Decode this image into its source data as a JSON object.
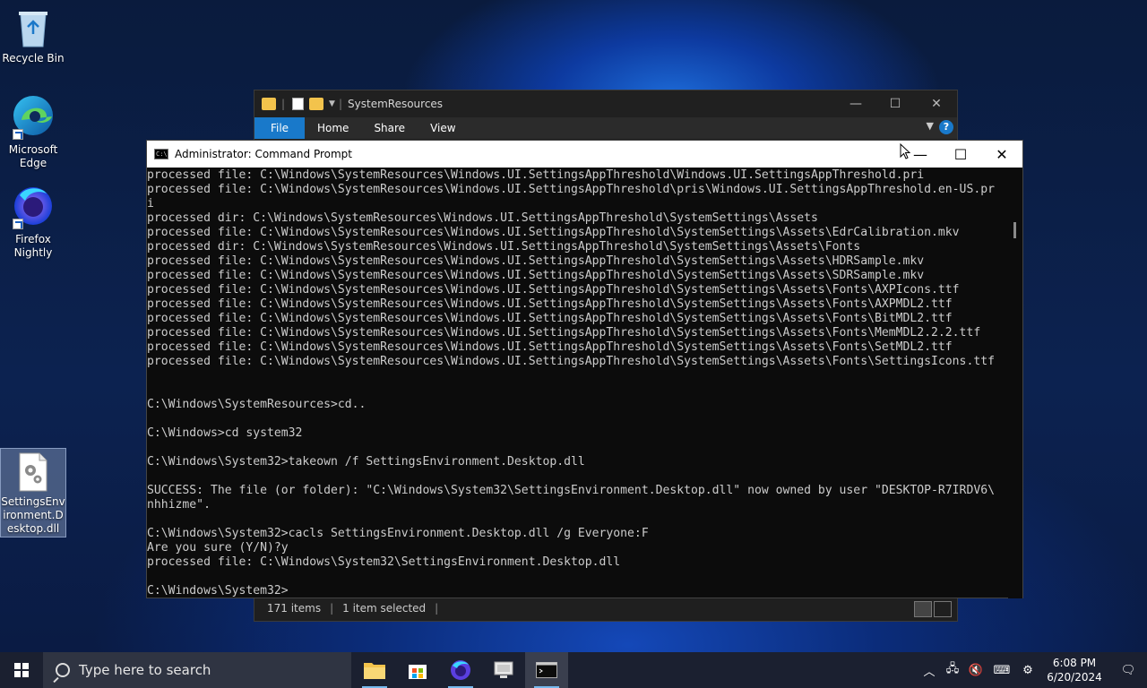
{
  "desktop": {
    "icons": [
      {
        "label": "Recycle Bin",
        "icon": "recycle-bin-icon"
      },
      {
        "label": "Microsoft Edge",
        "icon": "edge-icon"
      },
      {
        "label": "Firefox Nightly",
        "icon": "firefox-nightly-icon"
      },
      {
        "label": "SettingsEnvironment.Desktop.dll",
        "icon": "dll-file-icon"
      }
    ]
  },
  "explorer": {
    "title": "SystemResources",
    "tabs": [
      "File",
      "Home",
      "Share",
      "View"
    ],
    "status": {
      "items": "171 items",
      "selected": "1 item selected"
    },
    "help": "?"
  },
  "cmd": {
    "title": "Administrator: Command Prompt",
    "lines": [
      "processed file: C:\\Windows\\SystemResources\\Windows.UI.SettingsAppThreshold\\Windows.UI.SettingsAppThreshold.pri",
      "processed file: C:\\Windows\\SystemResources\\Windows.UI.SettingsAppThreshold\\pris\\Windows.UI.SettingsAppThreshold.en-US.pr",
      "i",
      "processed dir: C:\\Windows\\SystemResources\\Windows.UI.SettingsAppThreshold\\SystemSettings\\Assets",
      "processed file: C:\\Windows\\SystemResources\\Windows.UI.SettingsAppThreshold\\SystemSettings\\Assets\\EdrCalibration.mkv",
      "processed dir: C:\\Windows\\SystemResources\\Windows.UI.SettingsAppThreshold\\SystemSettings\\Assets\\Fonts",
      "processed file: C:\\Windows\\SystemResources\\Windows.UI.SettingsAppThreshold\\SystemSettings\\Assets\\HDRSample.mkv",
      "processed file: C:\\Windows\\SystemResources\\Windows.UI.SettingsAppThreshold\\SystemSettings\\Assets\\SDRSample.mkv",
      "processed file: C:\\Windows\\SystemResources\\Windows.UI.SettingsAppThreshold\\SystemSettings\\Assets\\Fonts\\AXPIcons.ttf",
      "processed file: C:\\Windows\\SystemResources\\Windows.UI.SettingsAppThreshold\\SystemSettings\\Assets\\Fonts\\AXPMDL2.ttf",
      "processed file: C:\\Windows\\SystemResources\\Windows.UI.SettingsAppThreshold\\SystemSettings\\Assets\\Fonts\\BitMDL2.ttf",
      "processed file: C:\\Windows\\SystemResources\\Windows.UI.SettingsAppThreshold\\SystemSettings\\Assets\\Fonts\\MemMDL2.2.2.ttf",
      "processed file: C:\\Windows\\SystemResources\\Windows.UI.SettingsAppThreshold\\SystemSettings\\Assets\\Fonts\\SetMDL2.ttf",
      "processed file: C:\\Windows\\SystemResources\\Windows.UI.SettingsAppThreshold\\SystemSettings\\Assets\\Fonts\\SettingsIcons.ttf",
      "",
      "",
      "C:\\Windows\\SystemResources>cd..",
      "",
      "C:\\Windows>cd system32",
      "",
      "C:\\Windows\\System32>takeown /f SettingsEnvironment.Desktop.dll",
      "",
      "SUCCESS: The file (or folder): \"C:\\Windows\\System32\\SettingsEnvironment.Desktop.dll\" now owned by user \"DESKTOP-R7IRDV6\\",
      "nhhizme\".",
      "",
      "C:\\Windows\\System32>cacls SettingsEnvironment.Desktop.dll /g Everyone:F",
      "Are you sure (Y/N)?y",
      "processed file: C:\\Windows\\System32\\SettingsEnvironment.Desktop.dll",
      "",
      "C:\\Windows\\System32>"
    ]
  },
  "taskbar": {
    "search_placeholder": "Type here to search",
    "apps": [
      "File Explorer",
      "Microsoft Store",
      "Firefox Nightly",
      "Remote Desktop",
      "Command Prompt"
    ],
    "time": "6:08 PM",
    "date": "6/20/2024"
  },
  "colors": {
    "accent": "#1979ca",
    "cmd_text": "#cccccc",
    "cmd_bg": "#0c0c0c"
  }
}
